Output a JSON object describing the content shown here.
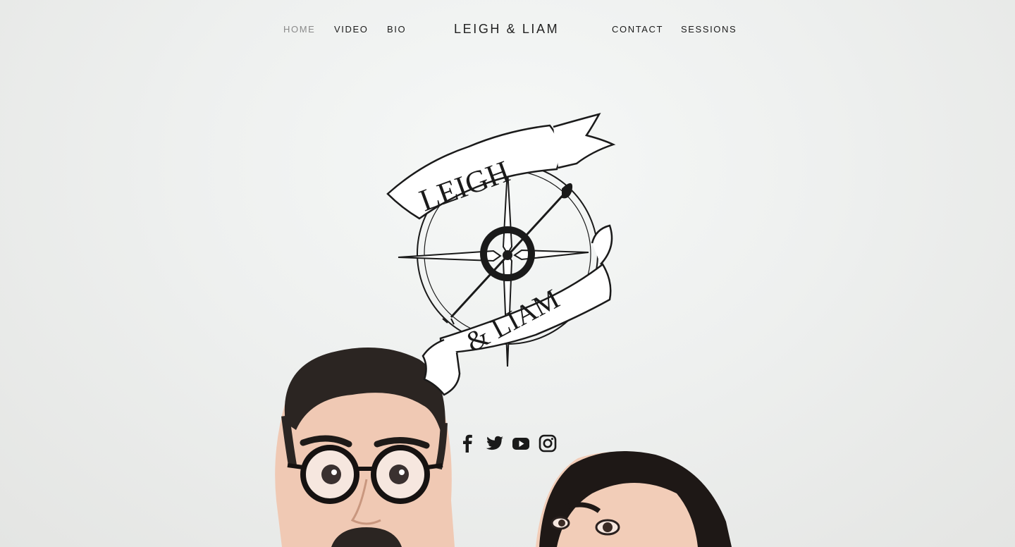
{
  "nav": {
    "left": [
      {
        "label": "HOME",
        "active": true
      },
      {
        "label": "VIDEO",
        "active": false
      },
      {
        "label": "BIO",
        "active": false
      }
    ],
    "brand": "LEIGH & LIAM",
    "right": [
      {
        "label": "CONTACT"
      },
      {
        "label": "SESSIONS"
      }
    ]
  },
  "logo": {
    "line1": "LEIGH",
    "line2": "& LIAM"
  },
  "social": [
    "facebook-icon",
    "twitter-icon",
    "youtube-icon",
    "instagram-icon"
  ],
  "colors": {
    "text": "#1b1b1b",
    "active": "#8a8a8a",
    "background": "#eef0ef"
  }
}
